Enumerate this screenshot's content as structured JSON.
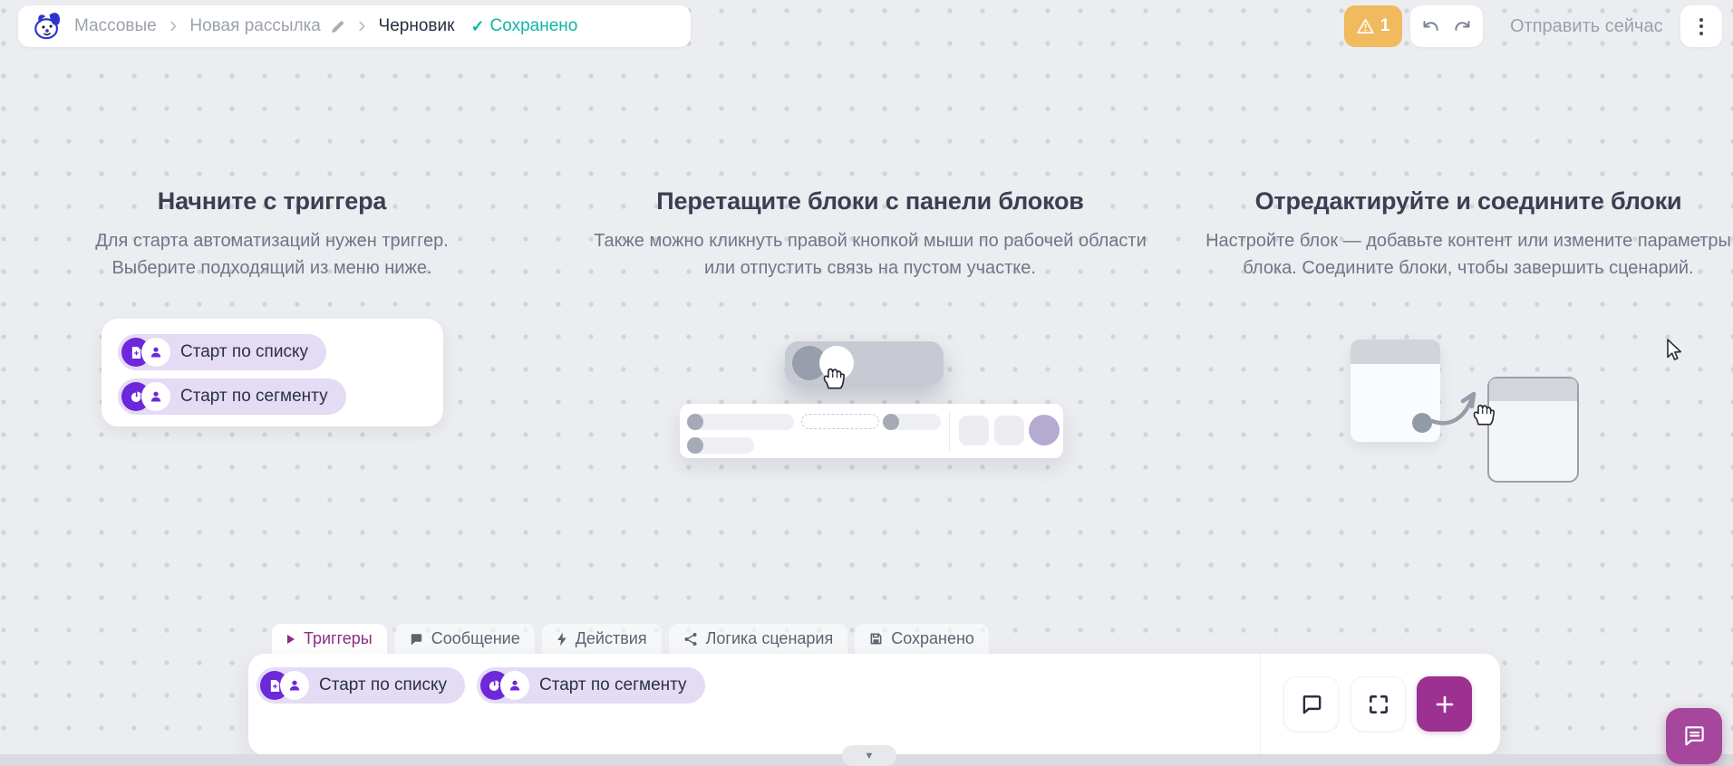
{
  "header": {
    "breadcrumb": [
      "Массовые",
      "Новая рассылка",
      "Черновик"
    ],
    "saved_status": "Сохранено",
    "warning_badge_count": "1",
    "send_now_label": "Отправить сейчас"
  },
  "onboarding_columns": [
    {
      "title": "Начните с триггера",
      "description": "Для старта автоматизаций нужен триггер. Выберите подходящий из меню ниже."
    },
    {
      "title": "Перетащите блоки с панели блоков",
      "description": "Также можно кликнуть правой кнопкой мыши по рабочей области или отпустить связь на пустом участке."
    },
    {
      "title": "Отредактируйте и соедините блоки",
      "description": "Настройте блок — добавьте контент или измените параметры блока. Соедините блоки, чтобы завершить сценарий."
    }
  ],
  "trigger_chips": {
    "start_by_list": "Старт по списку",
    "start_by_segment": "Старт по сегменту"
  },
  "tabs": [
    {
      "label": "Триггеры",
      "icon": "play-icon",
      "active": true
    },
    {
      "label": "Сообщение",
      "icon": "chat-bubble-icon",
      "active": false
    },
    {
      "label": "Действия",
      "icon": "lightning-icon",
      "active": false
    },
    {
      "label": "Логика сценария",
      "icon": "share-icon",
      "active": false
    },
    {
      "label": "Сохранено",
      "icon": "save-icon",
      "active": false
    }
  ],
  "icons": {
    "breadcrumb_separator": "›",
    "saved_check": "✓",
    "collapse_chevron": "▼"
  },
  "colors": {
    "saved_teal": "#10b5a4",
    "warning_orange": "#f1ba5e",
    "trigger_purple": "#6d28d9",
    "chip_lavender": "#e4dbf4",
    "brand_magenta": "#9d3191",
    "active_tab_text": "#8e2d86"
  }
}
